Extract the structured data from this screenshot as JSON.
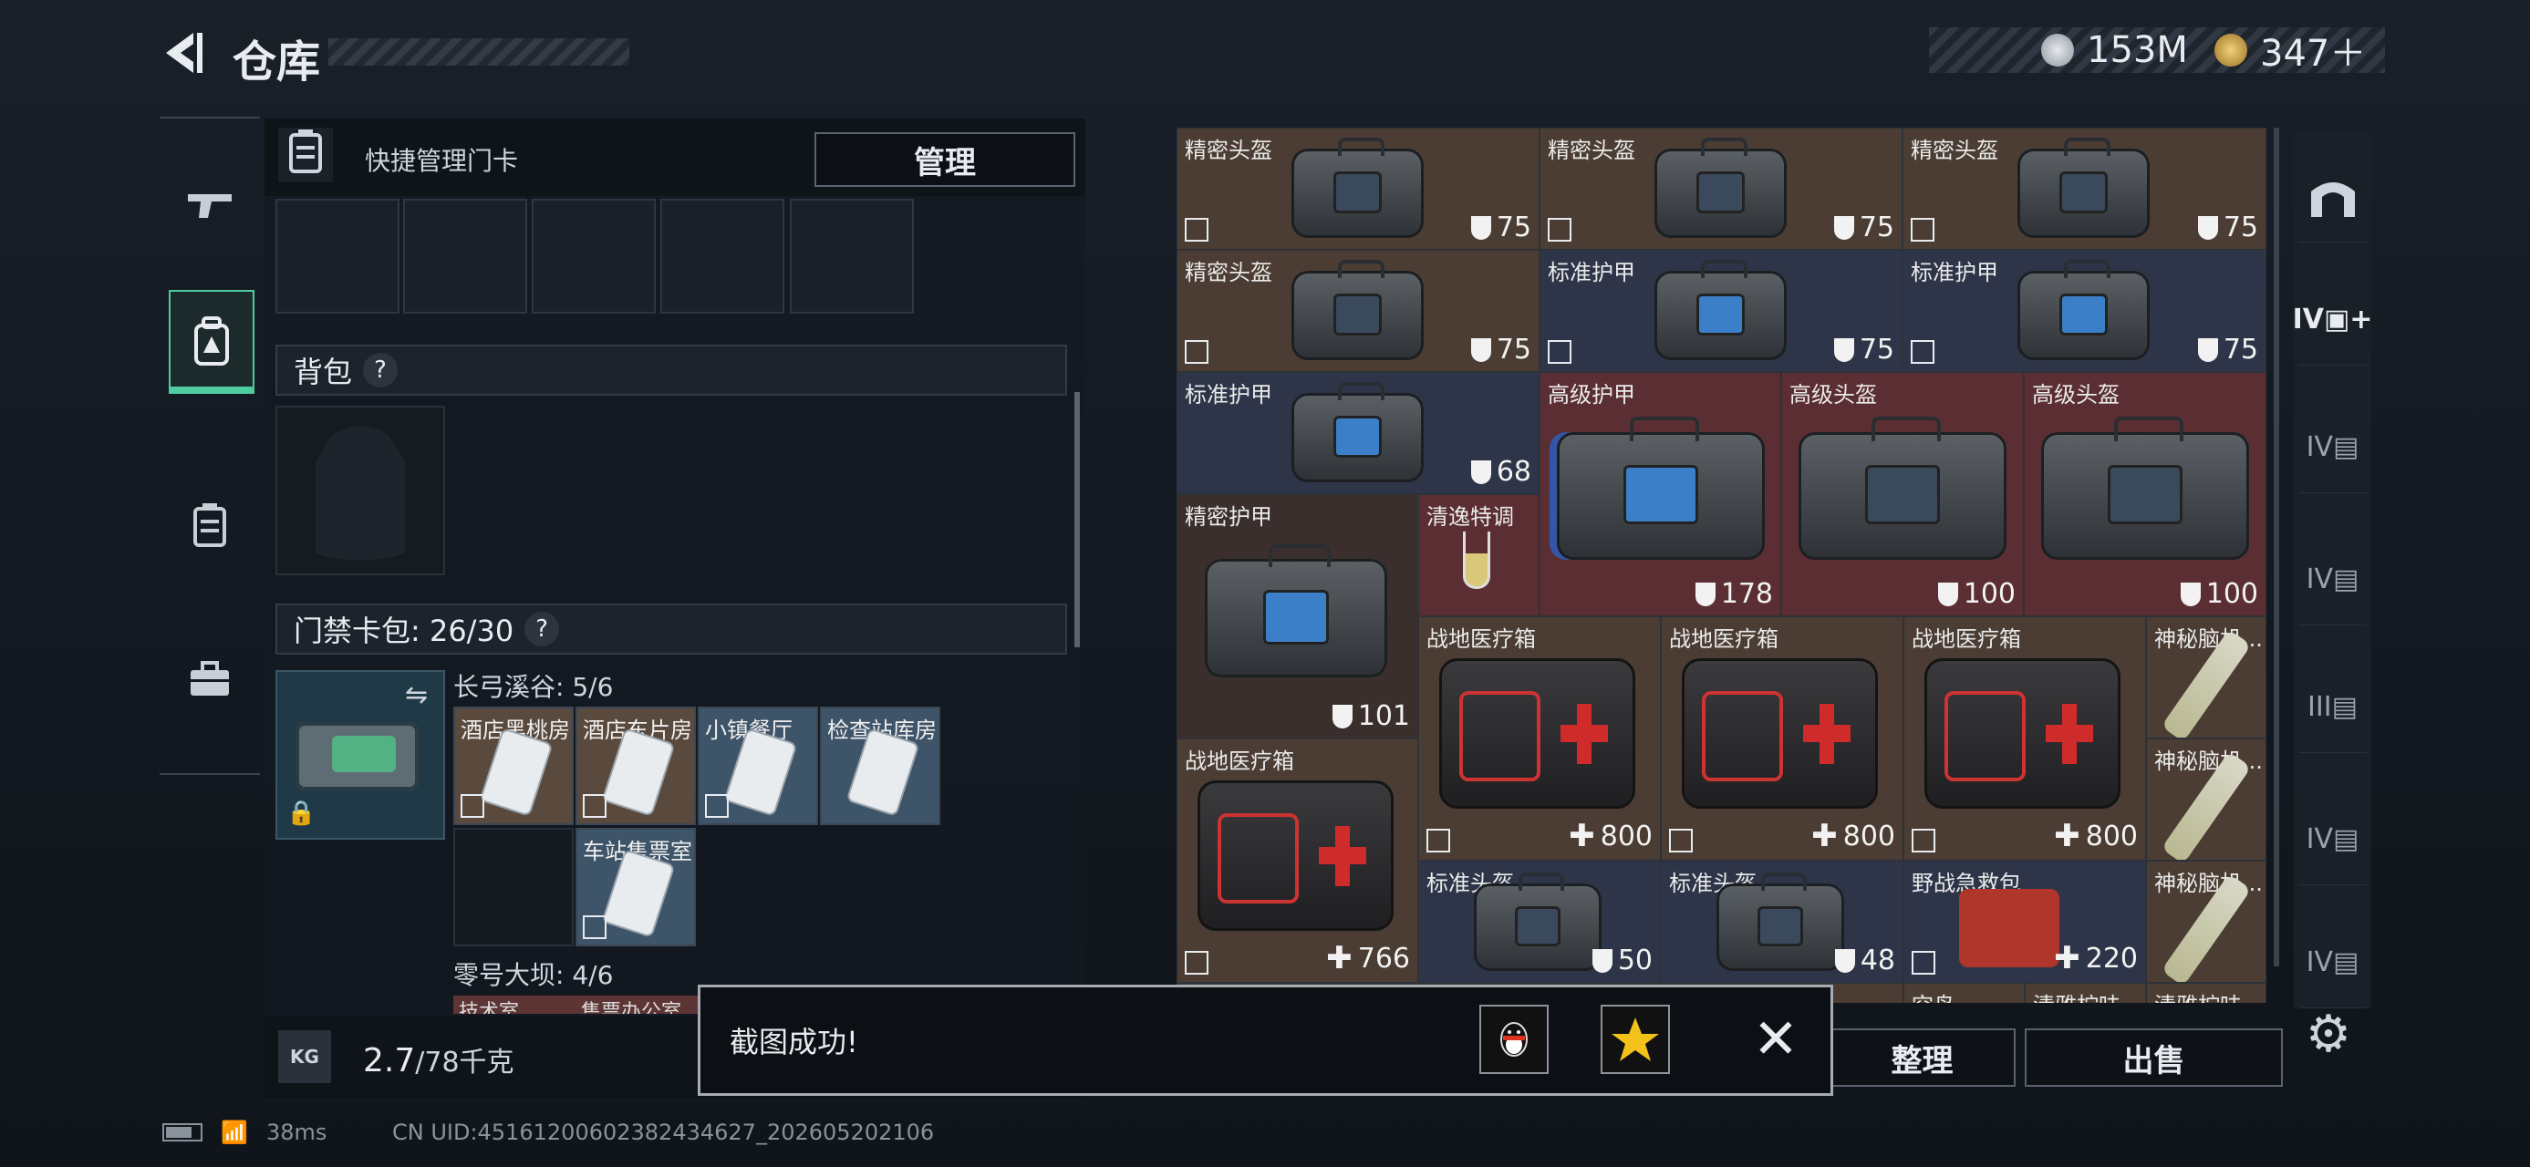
{
  "header": {
    "title": "仓库"
  },
  "currency": [
    {
      "value": "153M",
      "color": "#c9ced4"
    },
    {
      "value": "347＋",
      "color": "#d7a84a"
    }
  ],
  "leftnav": [
    {
      "name": "gun-icon",
      "glyph": "⌐"
    },
    {
      "name": "backpack-icon",
      "glyph": "⛉"
    },
    {
      "name": "card-case-icon",
      "glyph": "▤"
    },
    {
      "name": "toolbox-icon",
      "glyph": "🧰"
    }
  ],
  "quick": {
    "label": "快捷管理门卡",
    "manage": "管理"
  },
  "backpack": {
    "label": "背包",
    "help": "?"
  },
  "keycard_pack": {
    "label": "门禁卡包: 26/30",
    "help": "?"
  },
  "group1": {
    "label": "长弓溪谷: 5/6",
    "cards": [
      "酒店黑桃房",
      "酒店东片房",
      "小镇餐厅",
      "检查站库房",
      "车站售票室"
    ]
  },
  "group2": {
    "label": "零号大坝: 4/6",
    "partial": [
      "技术室",
      "售票办公室"
    ]
  },
  "weight": {
    "current": "2.7",
    "max": "/78千克",
    "icon": "KG"
  },
  "grid": [
    {
      "name": "精密头盔",
      "value": "75"
    },
    {
      "name": "精密头盔",
      "value": "75"
    },
    {
      "name": "精密头盔",
      "value": "75"
    },
    {
      "name": "精密头盔",
      "value": "75"
    },
    {
      "name": "标准护甲",
      "value": "75"
    },
    {
      "name": "标准护甲",
      "value": "75"
    },
    {
      "name": "标准护甲",
      "value": "68"
    },
    {
      "name": "高级护甲",
      "value": "178"
    },
    {
      "name": "高级头盔",
      "value": "100"
    },
    {
      "name": "高级头盔",
      "value": "100"
    },
    {
      "name": "精密护甲",
      "value": "101"
    },
    {
      "name": "清逸特调",
      "value": ""
    },
    {
      "name": "战地医疗箱",
      "value": "800"
    },
    {
      "name": "战地医疗箱",
      "value": "800"
    },
    {
      "name": "战地医疗箱",
      "value": "800"
    },
    {
      "name": "神秘脑机...",
      "value": ""
    },
    {
      "name": "神秘脑机...",
      "value": ""
    },
    {
      "name": "战地医疗箱",
      "value": "766"
    },
    {
      "name": "标准头盔",
      "value": "50"
    },
    {
      "name": "标准头盔",
      "value": "48"
    },
    {
      "name": "野战急救包",
      "value": "220"
    },
    {
      "name": "神秘脑机...",
      "value": ""
    },
    {
      "name": "空岛",
      "value": ""
    },
    {
      "name": "清雅柠味",
      "value": ""
    },
    {
      "name": "清雅柠味",
      "value": ""
    }
  ],
  "bottom": {
    "sort": "整理",
    "sell": "出售"
  },
  "toast": {
    "message": "截图成功!"
  },
  "status": {
    "ping": "38ms",
    "uid": "CN UID:45161200602382434627_202605202106"
  },
  "colors": {
    "accent": "#4ecca0",
    "brown": "#4b3d33",
    "navy": "#2e3548",
    "red": "#5b2e33"
  }
}
